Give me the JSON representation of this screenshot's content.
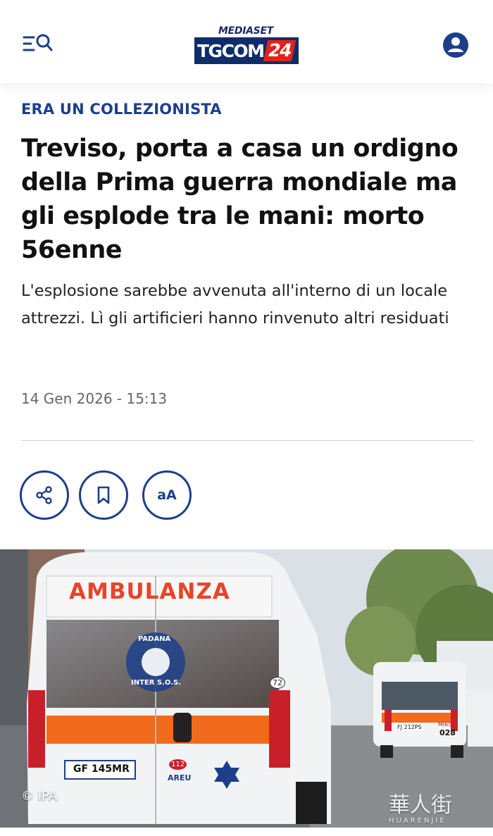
{
  "header": {
    "logo_top": "MEDIASET",
    "logo_tg": "TGCOM",
    "logo_num": "24",
    "menu_icon": "menu-search-icon",
    "user_icon": "user-account-icon"
  },
  "article": {
    "kicker": "ERA UN COLLEZIONISTA",
    "headline": "Treviso, porta a casa un ordigno della Prima guerra mondiale ma gli esplode tra le mani: morto 56enne",
    "summary": "L'esplosione sarebbe avvenuta all'interno di un locale attrezzi. Lì gli artificieri hanno rinvenuto altri residuati",
    "date": "14 Gen 2026 - 15:13"
  },
  "actions": {
    "share_icon": "share-icon",
    "bookmark_icon": "bookmark-icon",
    "font_size_label": "aA"
  },
  "photo": {
    "credit": "© IPA",
    "ambulance_text": "AMBULANZA",
    "badge_top": "PADANA",
    "badge_bottom": "INTER S.O.S.",
    "plate_main": "GF 145MR",
    "unit_number": "72",
    "emergency_num": "112",
    "areu": "AREU",
    "second_plate": "FJ 212PS",
    "second_code": "MI655",
    "second_number": "028",
    "watermark_text": "華人街",
    "watermark_sub": "HUARENJIE"
  },
  "colors": {
    "brand_blue": "#1d3f8a",
    "logo_navy": "#0f2d6b",
    "logo_red": "#e2231a",
    "ambulance_orange": "#f26a1b"
  }
}
